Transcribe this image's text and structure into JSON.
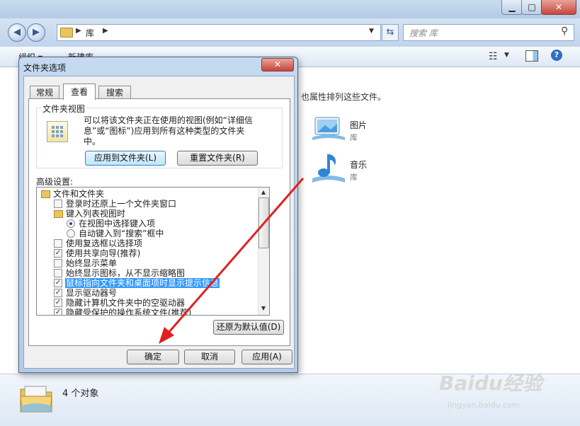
{
  "explorer": {
    "address": {
      "path": "库"
    },
    "search": {
      "placeholder": "搜索 库"
    },
    "toolbar": {
      "organize": "组织 ▾",
      "new": "新建库"
    },
    "library_description": "也属性排列这些文件。",
    "libraries": [
      {
        "name": "图片",
        "type": "库",
        "icon": "pictures-library-icon"
      },
      {
        "name": "音乐",
        "type": "库",
        "icon": "music-library-icon"
      }
    ],
    "details": {
      "count": "4 个对象"
    },
    "watermark": "Baidu经验",
    "watermark_url": "jingyan.baidu.com"
  },
  "dialog": {
    "title": "文件夹选项",
    "tabs": [
      "常规",
      "查看",
      "搜索"
    ],
    "selected_tab": "查看",
    "folder_views": {
      "legend": "文件夹视图",
      "description": "可以将该文件夹正在使用的视图(例如“详细信息”或“图标”)应用到所有这种类型的文件夹中。",
      "apply_button": "应用到文件夹(L)",
      "reset_button": "重置文件夹(R)"
    },
    "advanced": {
      "label": "高级设置:",
      "items": [
        {
          "text": "文件和文件夹",
          "kind": "folder",
          "indent": 0
        },
        {
          "text": "登录时还原上一个文件夹窗口",
          "kind": "checkbox",
          "checked": false,
          "indent": 1
        },
        {
          "text": "键入列表视图时",
          "kind": "folder",
          "indent": 1
        },
        {
          "text": "在视图中选择键入项",
          "kind": "radio",
          "checked": true,
          "indent": 2
        },
        {
          "text": "自动键入到“搜索”框中",
          "kind": "radio",
          "checked": false,
          "indent": 2
        },
        {
          "text": "使用复选框以选择项",
          "kind": "checkbox",
          "checked": false,
          "indent": 1
        },
        {
          "text": "使用共享向导(推荐)",
          "kind": "checkbox",
          "checked": true,
          "indent": 1
        },
        {
          "text": "始终显示菜单",
          "kind": "checkbox",
          "checked": false,
          "indent": 1
        },
        {
          "text": "始终显示图标，从不显示缩略图",
          "kind": "checkbox",
          "checked": false,
          "indent": 1
        },
        {
          "text": "鼠标指向文件夹和桌面项时显示提示信息",
          "kind": "checkbox",
          "checked": true,
          "indent": 1,
          "highlighted": true
        },
        {
          "text": "显示驱动器号",
          "kind": "checkbox",
          "checked": true,
          "indent": 1
        },
        {
          "text": "隐藏计算机文件夹中的空驱动器",
          "kind": "checkbox",
          "checked": true,
          "indent": 1
        },
        {
          "text": "隐藏受保护的操作系统文件(推荐)",
          "kind": "checkbox",
          "checked": true,
          "indent": 1
        }
      ],
      "restore_button": "还原为默认值(D)"
    },
    "buttons": {
      "ok": "确定",
      "cancel": "取消",
      "apply": "应用(A)"
    }
  },
  "colors": {
    "highlight": "#3399ff",
    "annotation_arrow": "#e02020"
  }
}
